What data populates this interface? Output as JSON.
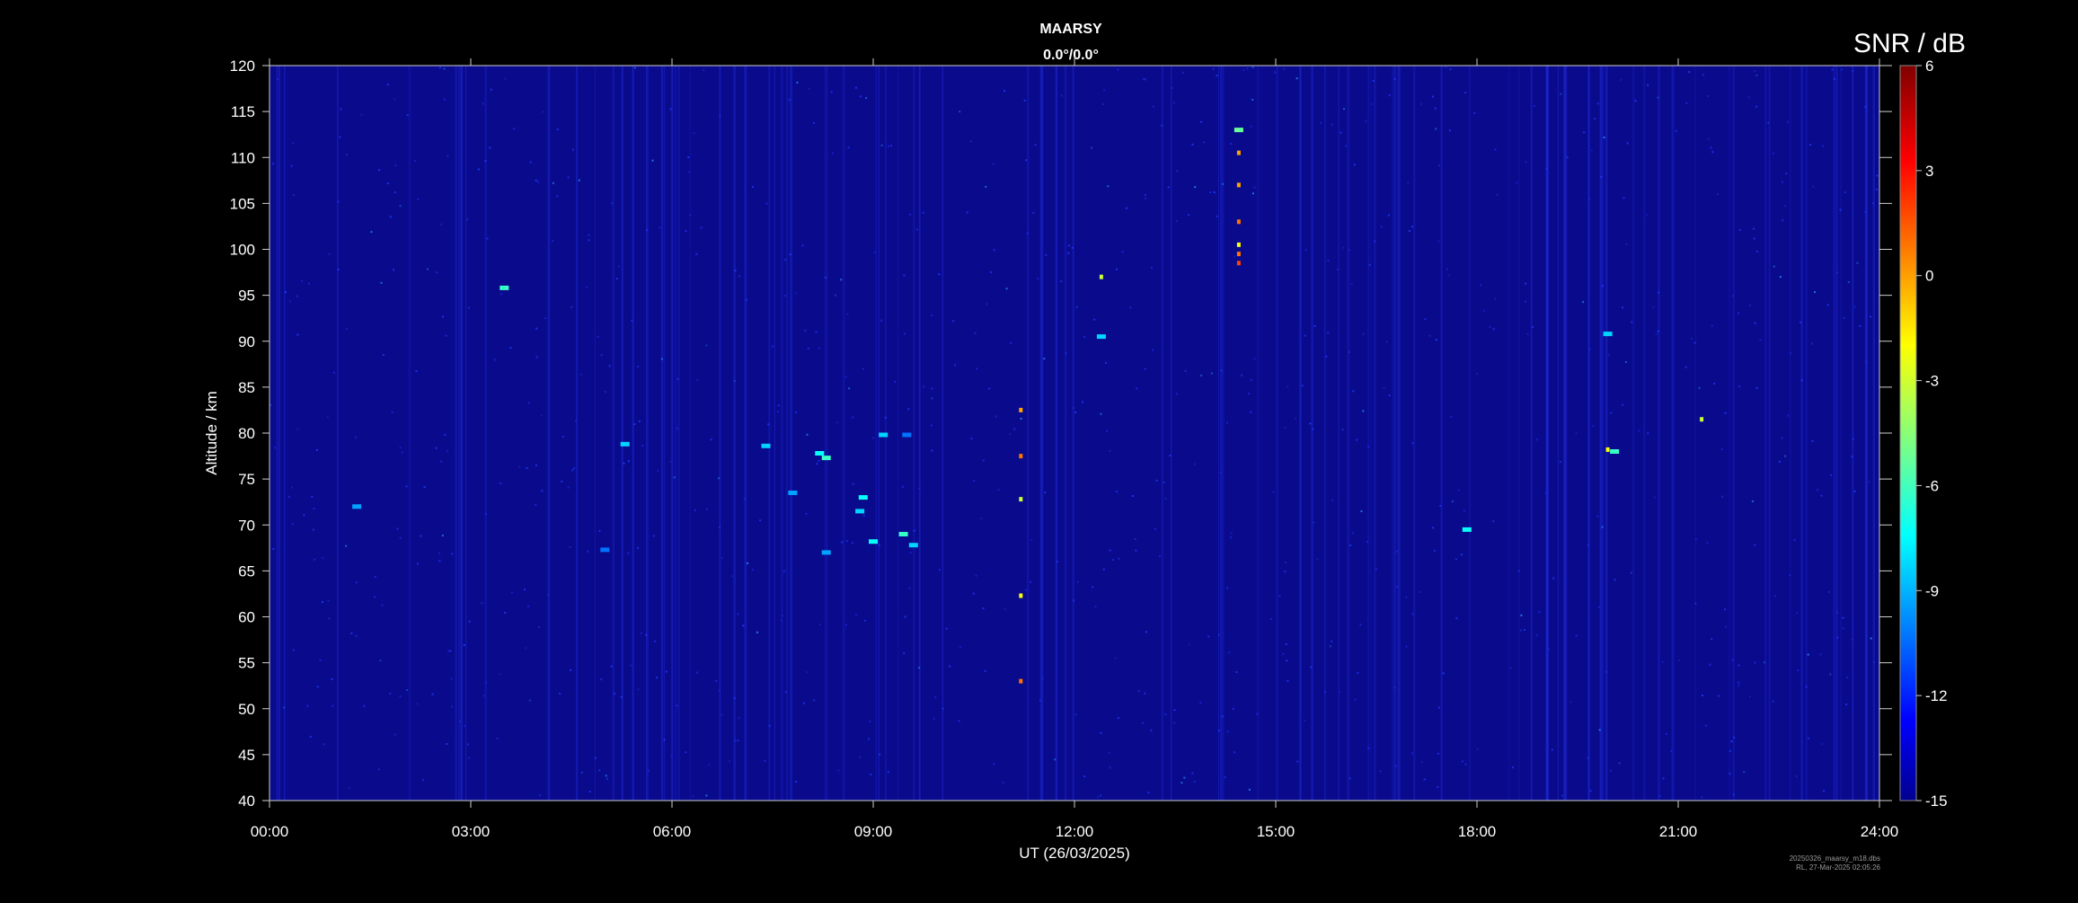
{
  "chart_data": {
    "type": "heatmap",
    "title": "MAARSY",
    "subtitle": "0.0°/0.0°",
    "xlabel": "UT (26/03/2025)",
    "ylabel": "Altitude / km",
    "colorbar_label": "SNR / dB",
    "x_ticks": [
      "00:00",
      "03:00",
      "06:00",
      "09:00",
      "12:00",
      "15:00",
      "18:00",
      "21:00",
      "24:00"
    ],
    "xlim_hours": [
      0,
      24
    ],
    "y_ticks": [
      40,
      45,
      50,
      55,
      60,
      65,
      70,
      75,
      80,
      85,
      90,
      95,
      100,
      105,
      110,
      115,
      120
    ],
    "ylim": [
      40,
      120
    ],
    "colorbar_ticks": [
      6,
      3,
      0,
      -3,
      -6,
      -9,
      -12,
      -15
    ],
    "clim": [
      -15,
      6
    ],
    "colormap": "jet",
    "background_level_db": -13.5,
    "grid": false,
    "features": [
      {
        "t": 5.3,
        "alt": 78.8,
        "snr": -8
      },
      {
        "t": 7.4,
        "alt": 78.6,
        "snr": -8
      },
      {
        "t": 8.2,
        "alt": 77.8,
        "snr": -7
      },
      {
        "t": 8.3,
        "alt": 77.3,
        "snr": -6
      },
      {
        "t": 9.15,
        "alt": 79.8,
        "snr": -8
      },
      {
        "t": 9.5,
        "alt": 79.8,
        "snr": -10
      },
      {
        "t": 7.8,
        "alt": 73.5,
        "snr": -9
      },
      {
        "t": 8.85,
        "alt": 73.0,
        "snr": -7
      },
      {
        "t": 8.8,
        "alt": 71.5,
        "snr": -8
      },
      {
        "t": 9.45,
        "alt": 69.0,
        "snr": -6
      },
      {
        "t": 9.0,
        "alt": 68.2,
        "snr": -7
      },
      {
        "t": 9.6,
        "alt": 67.8,
        "snr": -8
      },
      {
        "t": 8.3,
        "alt": 67.0,
        "snr": -9
      },
      {
        "t": 5.0,
        "alt": 67.3,
        "snr": -10
      },
      {
        "t": 1.3,
        "alt": 72.0,
        "snr": -9
      },
      {
        "t": 11.2,
        "alt": 82.5,
        "snr": 0
      },
      {
        "t": 11.2,
        "alt": 77.5,
        "snr": 1
      },
      {
        "t": 11.2,
        "alt": 72.8,
        "snr": -3
      },
      {
        "t": 11.2,
        "alt": 62.3,
        "snr": -2
      },
      {
        "t": 11.2,
        "alt": 53.0,
        "snr": 1
      },
      {
        "t": 12.4,
        "alt": 97.0,
        "snr": -3
      },
      {
        "t": 12.4,
        "alt": 90.5,
        "snr": -8
      },
      {
        "t": 14.45,
        "alt": 113.0,
        "snr": -5
      },
      {
        "t": 14.45,
        "alt": 110.5,
        "snr": 0
      },
      {
        "t": 14.45,
        "alt": 107.0,
        "snr": 0
      },
      {
        "t": 14.45,
        "alt": 103.0,
        "snr": 1
      },
      {
        "t": 14.45,
        "alt": 100.5,
        "snr": -2
      },
      {
        "t": 14.45,
        "alt": 99.5,
        "snr": 1
      },
      {
        "t": 14.45,
        "alt": 98.5,
        "snr": 2
      },
      {
        "t": 17.85,
        "alt": 69.5,
        "snr": -7
      },
      {
        "t": 19.95,
        "alt": 78.2,
        "snr": -2
      },
      {
        "t": 20.05,
        "alt": 78.0,
        "snr": -6
      },
      {
        "t": 19.95,
        "alt": 90.8,
        "snr": -8
      },
      {
        "t": 21.35,
        "alt": 81.5,
        "snr": -3
      },
      {
        "t": 3.5,
        "alt": 95.8,
        "snr": -6
      }
    ]
  },
  "footer": {
    "line1": "20250326_maarsy_m18.dbs",
    "line2": "RL, 27-Mar-2025 02:05:26"
  }
}
